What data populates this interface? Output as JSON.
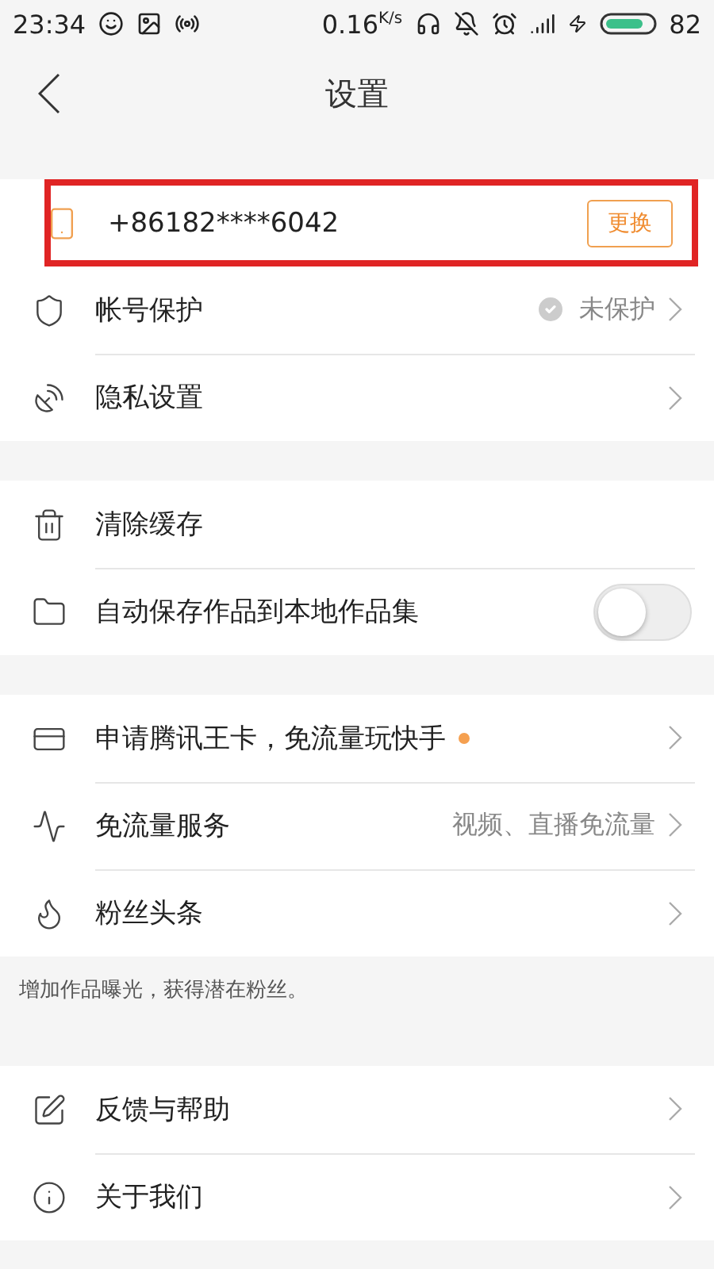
{
  "status_bar": {
    "time": "23:34",
    "speed": "0.16",
    "speed_unit": "K/s",
    "battery": "82"
  },
  "header": {
    "title": "设置"
  },
  "sections": [
    {
      "rows": [
        {
          "kind": "phone",
          "label": "+86182****6042",
          "button": "更换",
          "highlighted": true
        },
        {
          "kind": "nav",
          "label": "帐号保护",
          "value": "未保护",
          "value_checked": false
        },
        {
          "kind": "nav",
          "label": "隐私设置"
        }
      ]
    },
    {
      "rows": [
        {
          "kind": "plain",
          "label": "清除缓存"
        },
        {
          "kind": "toggle",
          "label": "自动保存作品到本地作品集",
          "on": false
        }
      ]
    },
    {
      "rows": [
        {
          "kind": "nav",
          "label": "申请腾讯王卡，免流量玩快手",
          "dot": true
        },
        {
          "kind": "nav",
          "label": "免流量服务",
          "value": "视频、直播免流量"
        },
        {
          "kind": "nav",
          "label": "粉丝头条"
        }
      ],
      "note": "增加作品曝光，获得潜在粉丝。"
    },
    {
      "rows": [
        {
          "kind": "nav",
          "label": "反馈与帮助"
        },
        {
          "kind": "nav",
          "label": "关于我们"
        }
      ]
    }
  ]
}
